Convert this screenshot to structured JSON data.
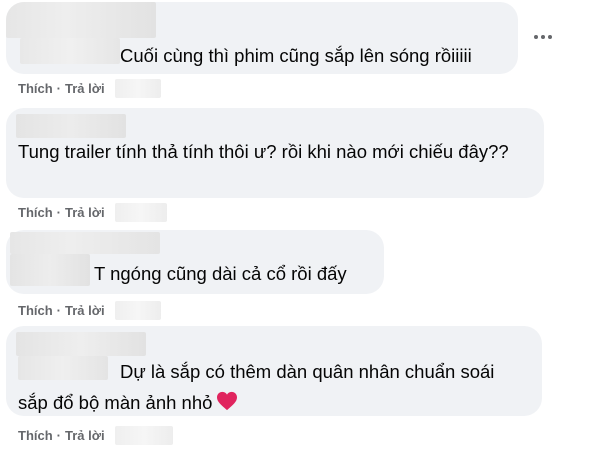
{
  "comments": [
    {
      "text": "Cuối cùng thì phim cũng sắp lên sóng rồiiiii"
    },
    {
      "text": "Tung trailer tính thả tính thôi ư? rồi khi nào mới chiếu đây??"
    },
    {
      "text": "T ngóng cũng dài cả cổ rồi đấy"
    },
    {
      "text": "Dự là sắp có thêm dàn quân nhân chuẩn soái sắp đổ bộ màn ảnh nhỏ"
    }
  ],
  "actions": {
    "like": "Thích",
    "reply": "Trả lời",
    "separator": "·"
  },
  "icons": {
    "more": "more-options-icon",
    "heart": "heart-icon"
  },
  "colors": {
    "bubble": "#f0f2f5",
    "action_text": "#65676b",
    "heart": "#e0245e"
  }
}
